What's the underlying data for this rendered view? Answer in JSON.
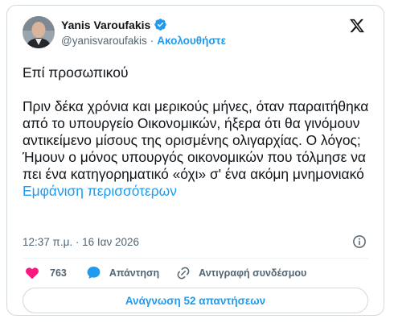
{
  "author": {
    "name": "Yanis Varoufakis",
    "handle": "@yanisvaroufakis",
    "separator": "·",
    "follow_label": "Ακολουθήστε"
  },
  "tweet": {
    "text": "Επί προσωπικού\n\nΠριν δέκα χρόνια και μερικούς μήνες, όταν παραιτήθηκα από το υπουργείο Οικονομικών, ήξερα ότι θα γινόμουν αντικείμενο μίσους της ορισμένης ολιγαρχίας. Ο λόγος; Ήμουν ο μόνος υπουργός οικονομικών που τόλμησε να πει ένα κατηγορηματικό «όχι» σ' ένα ακόμη μνημονιακό",
    "show_more": "Εμφάνιση περισσότερων",
    "timestamp": "12:37 π.μ. · 16 Ιαν 2026"
  },
  "actions": {
    "likes": "763",
    "reply": "Απάντηση",
    "copy_link": "Αντιγραφή συνδέσμου"
  },
  "read_replies": "Ανάγνωση 52 απαντήσεων",
  "colors": {
    "accent": "#1d9bf0",
    "like": "#f91880",
    "text": "#0f1419",
    "muted": "#536471"
  }
}
